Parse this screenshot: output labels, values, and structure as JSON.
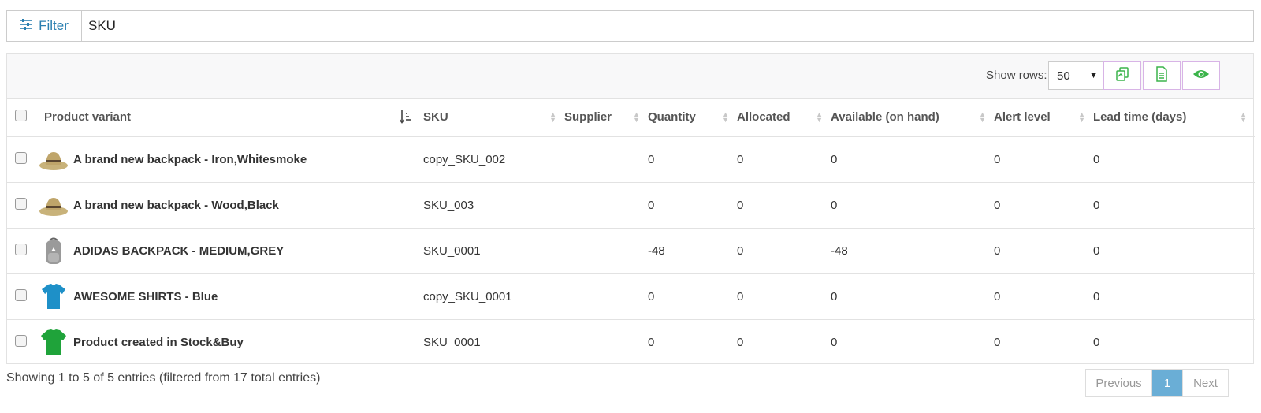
{
  "filter": {
    "button_label": "Filter",
    "input_value": "SKU"
  },
  "toolbar": {
    "show_rows_label": "Show rows:",
    "rows_value": "50"
  },
  "table": {
    "columns": [
      "Product variant",
      "SKU",
      "Supplier",
      "Quantity",
      "Allocated",
      "Available (on hand)",
      "Alert level",
      "Lead time (days)"
    ],
    "rows": [
      {
        "name": "A brand new backpack - Iron,Whitesmoke",
        "image": "hat-icon",
        "sku": "copy_SKU_002",
        "supplier": "",
        "quantity": "0",
        "allocated": "0",
        "available": "0",
        "alert": "0",
        "lead": "0"
      },
      {
        "name": "A brand new backpack - Wood,Black",
        "image": "hat-icon",
        "sku": "SKU_003",
        "supplier": "",
        "quantity": "0",
        "allocated": "0",
        "available": "0",
        "alert": "0",
        "lead": "0"
      },
      {
        "name": "ADIDAS BACKPACK - MEDIUM,GREY",
        "image": "backpack-icon",
        "sku": "SKU_0001",
        "supplier": "",
        "quantity": "-48",
        "allocated": "0",
        "available": "-48",
        "alert": "0",
        "lead": "0"
      },
      {
        "name": "AWESOME SHIRTS - Blue",
        "image": "blue-shirt-icon",
        "sku": "copy_SKU_0001",
        "supplier": "",
        "quantity": "0",
        "allocated": "0",
        "available": "0",
        "alert": "0",
        "lead": "0"
      },
      {
        "name": "Product created in Stock&Buy",
        "image": "green-shirt-icon",
        "sku": "SKU_0001",
        "supplier": "",
        "quantity": "0",
        "allocated": "0",
        "available": "0",
        "alert": "0",
        "lead": "0"
      }
    ]
  },
  "footer": {
    "info": "Showing 1 to 5 of 5 entries (filtered from 17 total entries)"
  },
  "pagination": {
    "previous": "Previous",
    "current": "1",
    "next": "Next"
  }
}
